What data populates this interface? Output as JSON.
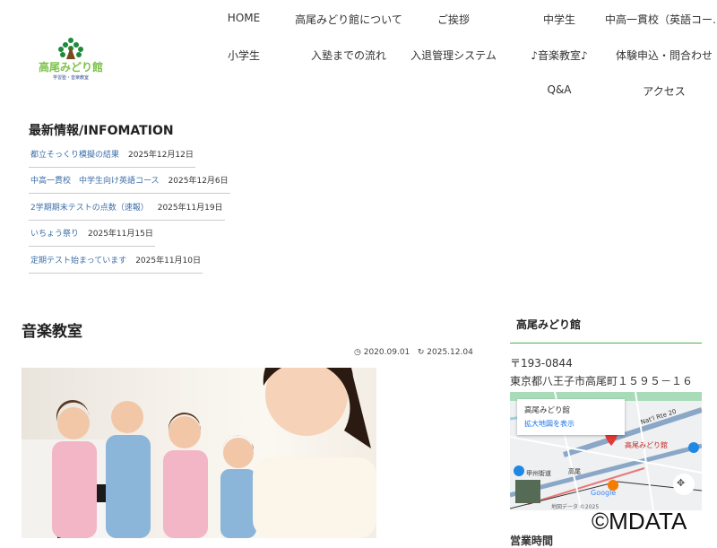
{
  "logo": {
    "name": "高尾みどり館",
    "sub": "学習塾・音楽教室"
  },
  "nav": [
    "HOME",
    "高尾みどり館について",
    "ご挨拶",
    "中学生",
    "中高一貫校（英語コー…",
    "小学生",
    "入塾までの流れ",
    "入退管理システム",
    "♪音楽教室♪",
    "体験申込・問合わせ",
    "Q&A",
    "アクセス"
  ],
  "news": {
    "title": "最新情報/INFOMATION",
    "items": [
      {
        "label": "都立そっくり模擬の結果",
        "date": "2025年12月12日"
      },
      {
        "label": "中高一貫校　中学生向け英語コース",
        "date": "2025年12月6日"
      },
      {
        "label": "2学期期末テストの点数（速報）",
        "date": "2025年11月19日"
      },
      {
        "label": "いちょう祭り",
        "date": "2025年11月15日"
      },
      {
        "label": "定期テスト始まっています",
        "date": "2025年11月10日"
      }
    ]
  },
  "article": {
    "title": "音楽教室",
    "published": "2020.09.01",
    "updated": "2025.12.04"
  },
  "sidebar": {
    "title": "高尾みどり館",
    "postal": "〒193-0844",
    "address": "東京都八王子市高尾町１５９５－１６",
    "map": {
      "place": "高尾みどり館",
      "link": "拡大地図を表示",
      "route": "Nat'l Rte 20",
      "station": "高尾",
      "street": "甲州街道",
      "google": "Google",
      "footer": "地図データ ©2025"
    },
    "next_heading": "営業時間"
  },
  "watermark": "©MDATA"
}
